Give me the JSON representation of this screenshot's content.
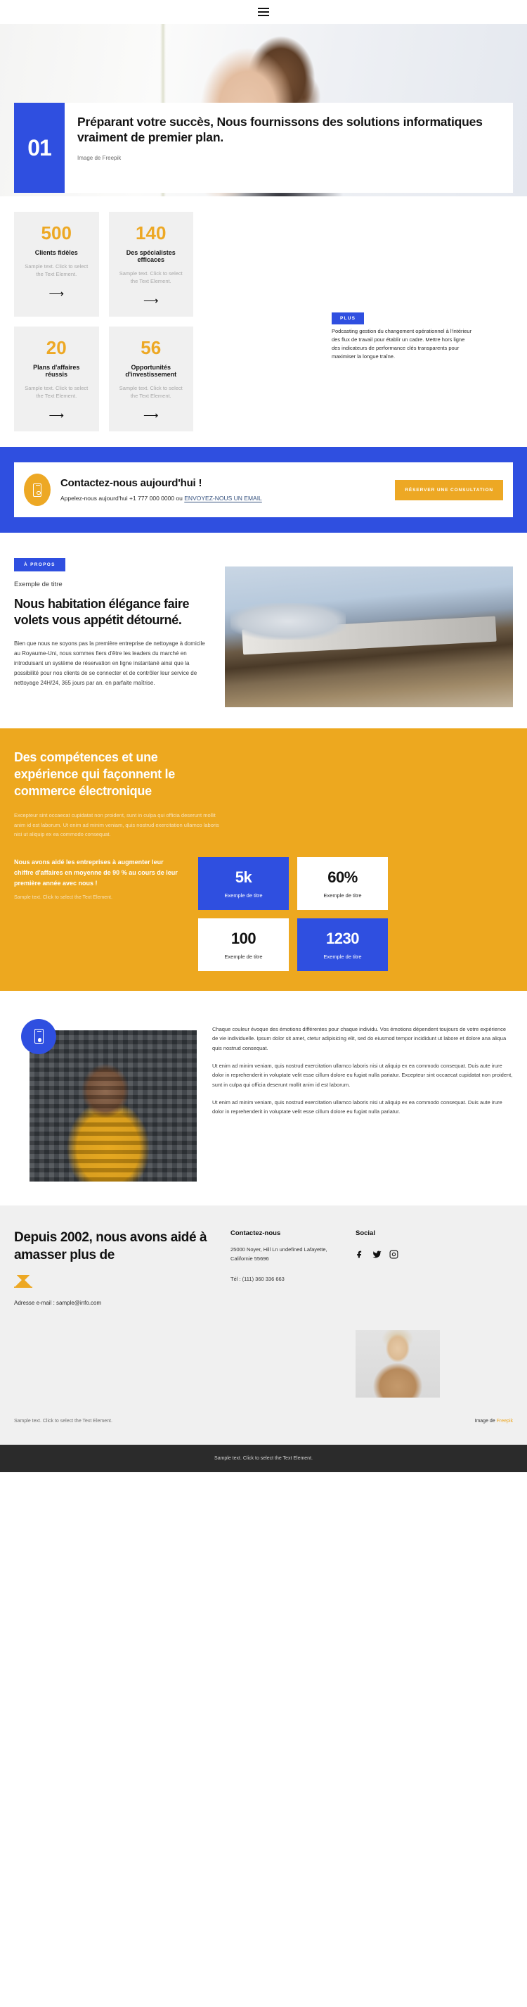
{
  "topbar": {
    "menu_icon": "hamburger-menu-icon"
  },
  "hero": {
    "number": "01",
    "title": "Préparant votre succès, Nous fournissons des solutions informatiques vraiment de premier plan.",
    "credit": "Image de  Freepik"
  },
  "stats": [
    {
      "number": "500",
      "label": "Clients fidèles",
      "desc": "Sample text. Click to select the Text Element.",
      "arrow": "arrow-right-icon"
    },
    {
      "number": "140",
      "label": "Des spécialistes efficaces",
      "desc": "Sample text. Click to select the Text Element.",
      "arrow": "arrow-right-icon"
    },
    {
      "number": "20",
      "label": "Plans d'affaires réussis",
      "desc": "Sample text. Click to select the Text Element.",
      "arrow": "arrow-right-icon"
    },
    {
      "number": "56",
      "label": "Opportunités d'investissement",
      "desc": "Sample text. Click to select the Text Element.",
      "arrow": "arrow-right-icon"
    }
  ],
  "plus_block": {
    "badge": "PLUS",
    "text": "Podcasting gestion du changement opérationnel à l'intérieur des flux de travail pour établir un cadre. Mettre hors ligne des indicateurs de performance clés transparents pour maximiser la longue traîne."
  },
  "contact_band": {
    "title": "Contactez-nous aujourd'hui !",
    "sub_prefix": "Appelez-nous aujourd'hui +1 777 000 0000 ou ",
    "sub_link": "ENVOYEZ-NOUS UN EMAIL",
    "button": "RÉSERVER UNE CONSULTATION",
    "icon": "mobile-phone-icon"
  },
  "about": {
    "badge": "À PROPOS",
    "eyebrow": "Exemple de titre",
    "title": "Nous habitation élégance faire volets vous appétit détourné.",
    "body": "Bien que nous ne soyons pas la première entreprise de nettoyage à domicile au Royaume-Uni, nous sommes fiers d'être les leaders du marché en introduisant un système de réservation en ligne instantané ainsi que la possibilité pour nos clients de se connecter et de contrôler leur service de nettoyage 24H/24, 365 jours par an. en parfaite maîtrise."
  },
  "orange": {
    "title": "Des compétences et une expérience qui façonnent le commerce électronique",
    "body": "Excepteur sint occaecat cupidatat non proident, sunt in culpa qui officia deserunt mollit anim id est laborum. Ut enim ad minim veniam, quis nostrud exercitation ullamco laboris nisi ut aliquip ex ea commodo consequat.",
    "pitch_title": "Nous avons aidé les entreprises à augmenter leur chiffre d'affaires en moyenne de 90 % au cours de leur première année avec nous !",
    "pitch_sub": "Sample text. Click to select the Text Element.",
    "kpis": [
      {
        "number": "5k",
        "label": "Exemple de titre",
        "style": "blue"
      },
      {
        "number": "60%",
        "label": "Exemple de titre",
        "style": "white"
      },
      {
        "number": "100",
        "label": "Exemple de titre",
        "style": "white"
      },
      {
        "number": "1230",
        "label": "Exemple de titre",
        "style": "blue"
      }
    ]
  },
  "article": {
    "icon": "mobile-phone-icon",
    "paragraphs": [
      "Chaque couleur évoque des émotions différentes pour chaque individu. Vos émotions dépendent toujours de votre expérience de vie individuelle. Ipsum dolor sit amet, ctetur adipisicing elit, sed do eiusmod tempor incididunt ut labore et dolore ana aliqua quis nostrud consequat.",
      "Ut enim ad minim veniam, quis nostrud exercitation ullamco laboris nisi ut aliquip ex ea commodo consequat. Duis aute irure dolor in reprehenderit in voluptate velit esse cillum dolore eu fugiat nulla pariatur. Excepteur sint occaecat cupidatat non proident, sunt in culpa qui officia deserunt mollit anim id est laborum.",
      "Ut enim ad minim veniam, quis nostrud exercitation ullamco laboris nisi ut aliquip ex ea commodo consequat. Duis aute irure dolor in reprehenderit in voluptate velit esse cillum dolore eu fugiat nulla pariatur."
    ]
  },
  "footer": {
    "title": "Depuis 2002, nous avons aidé à amasser plus de",
    "mail_icon": "envelope-icon",
    "mail_label": "Adresse e-mail : sample@info.com",
    "contact_heading": "Contactez-nous",
    "address": "25000 Noyer, Hill Ln undefined Lafayette, Californie 55696",
    "tel": "Tél :  (111) 360 336 663",
    "social_heading": "Social",
    "social": [
      "facebook-icon",
      "twitter-icon",
      "instagram-icon"
    ],
    "sample_note": "Sample text. Click to select the Text Element.",
    "image_credit_prefix": "Image de ",
    "image_credit_link": "Freepik"
  },
  "bottombar": {
    "text": "Sample text. Click to select the Text Element."
  },
  "colors": {
    "blue": "#2f4fe0",
    "orange": "#eda824",
    "orange_section": "#eda81f",
    "grey_bg": "#f0f0f0",
    "dark": "#2b2b2b"
  }
}
